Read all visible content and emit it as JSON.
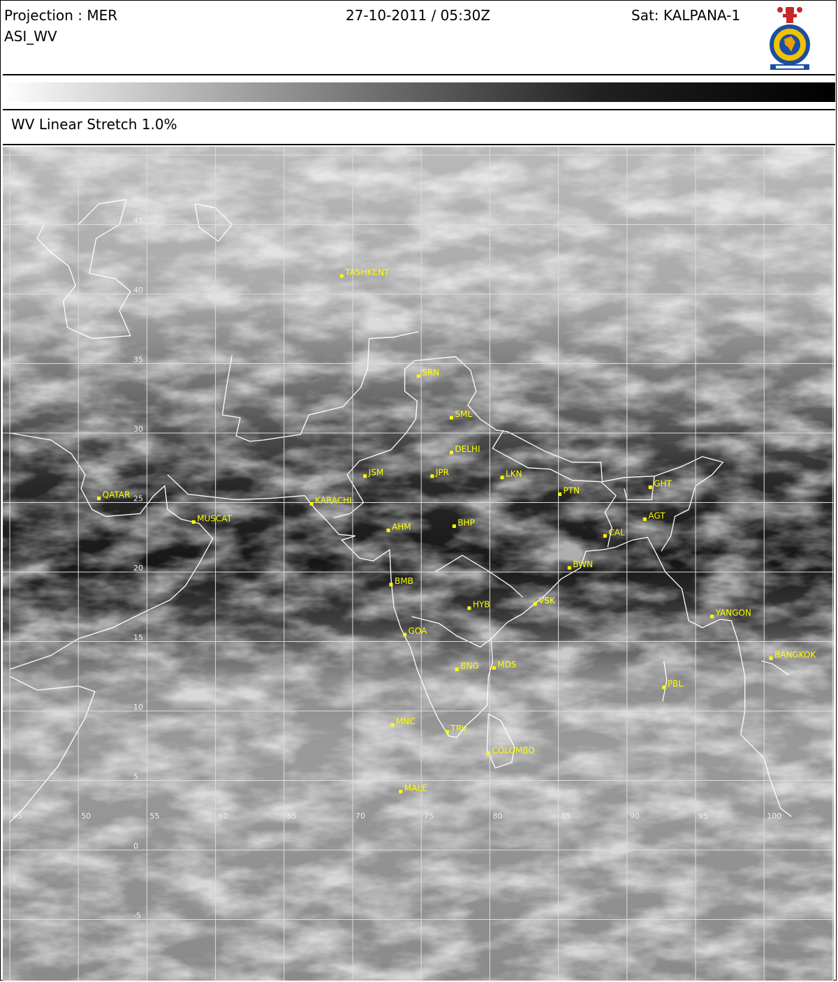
{
  "header": {
    "projection": "Projection : MER",
    "product": "ASI_WV",
    "datetime": "27-10-2011 / 05:30Z",
    "satellite": "Sat: KALPANA-1"
  },
  "colorbar": {
    "from": "#ffffff",
    "to": "#000000"
  },
  "stretch_label": "WV Linear Stretch 1.0%",
  "map": {
    "lon_labels": [
      "45",
      "50",
      "55",
      "60",
      "65",
      "70",
      "75",
      "80",
      "85",
      "90",
      "95",
      "100"
    ],
    "lat_labels": [
      "45",
      "40",
      "35",
      "30",
      "25",
      "20",
      "15",
      "10",
      "5",
      "0",
      "-5"
    ],
    "stations": [
      {
        "name": "TASHKENT",
        "lon": 69.2,
        "lat": 41.3
      },
      {
        "name": "SRN",
        "lon": 74.8,
        "lat": 34.1
      },
      {
        "name": "SML",
        "lon": 77.2,
        "lat": 31.1
      },
      {
        "name": "DELHI",
        "lon": 77.2,
        "lat": 28.6
      },
      {
        "name": "JSM",
        "lon": 70.9,
        "lat": 26.9
      },
      {
        "name": "JPR",
        "lon": 75.8,
        "lat": 26.9
      },
      {
        "name": "LKN",
        "lon": 80.9,
        "lat": 26.8
      },
      {
        "name": "PTN",
        "lon": 85.1,
        "lat": 25.6
      },
      {
        "name": "GHT",
        "lon": 91.7,
        "lat": 26.1
      },
      {
        "name": "QATAR",
        "lon": 51.5,
        "lat": 25.3
      },
      {
        "name": "KARACHI",
        "lon": 67.0,
        "lat": 24.9
      },
      {
        "name": "MUSCAT",
        "lon": 58.4,
        "lat": 23.6
      },
      {
        "name": "AHM",
        "lon": 72.6,
        "lat": 23.0
      },
      {
        "name": "BHP",
        "lon": 77.4,
        "lat": 23.3
      },
      {
        "name": "CAL",
        "lon": 88.4,
        "lat": 22.6
      },
      {
        "name": "AGT",
        "lon": 91.3,
        "lat": 23.8
      },
      {
        "name": "BWN",
        "lon": 85.8,
        "lat": 20.3
      },
      {
        "name": "BMB",
        "lon": 72.8,
        "lat": 19.1
      },
      {
        "name": "HYB",
        "lon": 78.5,
        "lat": 17.4
      },
      {
        "name": "VSK",
        "lon": 83.3,
        "lat": 17.7
      },
      {
        "name": "YANGON",
        "lon": 96.2,
        "lat": 16.8
      },
      {
        "name": "GOA",
        "lon": 73.8,
        "lat": 15.5
      },
      {
        "name": "BNG",
        "lon": 77.6,
        "lat": 13.0
      },
      {
        "name": "MDS",
        "lon": 80.3,
        "lat": 13.1
      },
      {
        "name": "BANGKOK",
        "lon": 100.5,
        "lat": 13.8
      },
      {
        "name": "PBL",
        "lon": 92.7,
        "lat": 11.7
      },
      {
        "name": "MNC",
        "lon": 72.9,
        "lat": 9.0
      },
      {
        "name": "TRV",
        "lon": 76.9,
        "lat": 8.5
      },
      {
        "name": "COLOMBO",
        "lon": 79.9,
        "lat": 6.9
      },
      {
        "name": "MALE",
        "lon": 73.5,
        "lat": 4.2
      }
    ]
  }
}
